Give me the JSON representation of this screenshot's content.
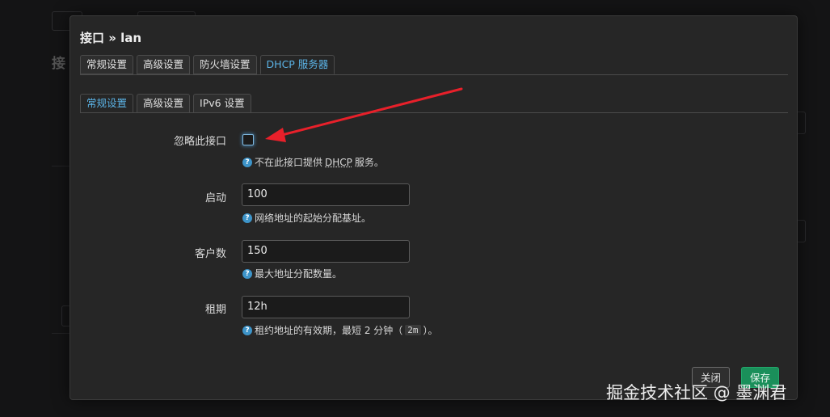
{
  "modal": {
    "title": "接口 » lan",
    "tabs": [
      "常规设置",
      "高级设置",
      "防火墙设置",
      "DHCP 服务器"
    ],
    "active_tab": 3,
    "subtabs": [
      "常规设置",
      "高级设置",
      "IPv6 设置"
    ],
    "active_subtab": 0
  },
  "form": {
    "ignore": {
      "label": "忽略此接口",
      "checked": false,
      "help_pre": "不在此接口提供",
      "help_abbr": "DHCP",
      "help_post": "服务。"
    },
    "start": {
      "label": "启动",
      "value": "100",
      "help": "网络地址的起始分配基址。"
    },
    "limit": {
      "label": "客户数",
      "value": "150",
      "help": "最大地址分配数量。"
    },
    "leasetime": {
      "label": "租期",
      "value": "12h",
      "help_pre": "租约地址的有效期，最短 2 分钟（",
      "help_code": "2m",
      "help_post": "）。"
    }
  },
  "buttons": {
    "close": "关闭",
    "save": "保存"
  },
  "background": {
    "heading_partial": "接"
  },
  "annotation": {
    "arrow_color": "#e8202a"
  },
  "watermark": "掘金技术社区 @ 墨渊君"
}
